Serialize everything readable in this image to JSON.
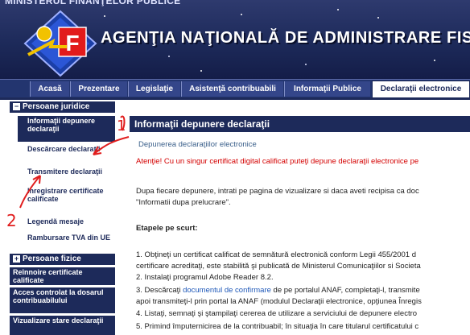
{
  "header": {
    "ministry": "MINISTERUL FINANŢELOR PUBLICE",
    "agency": "AGENŢIA NAŢIONALĂ DE ADMINISTRARE FISCALĂ"
  },
  "tabs": [
    {
      "label": "Acasă"
    },
    {
      "label": "Prezentare"
    },
    {
      "label": "Legislaţie"
    },
    {
      "label": "Asistenţă contribuabili"
    },
    {
      "label": "Informaţii Publice"
    },
    {
      "label": "Declaraţii electronice"
    }
  ],
  "sidebar": {
    "section1": "Persoane juridice",
    "section1_icon": "minus",
    "items": [
      {
        "label": "Informaţii depunere declaraţii"
      },
      {
        "label": "Descărcare declaraţii"
      },
      {
        "label": "Transmitere declaraţii"
      },
      {
        "label": "Inregistrare certificate calificate"
      },
      {
        "label": "Legendă mesaje"
      },
      {
        "label": "Rambursare TVA din UE"
      }
    ],
    "section2": "Persoane fizice",
    "section2_icon": "plus",
    "blocks": [
      {
        "label": "Reînnoire certificate calificate"
      },
      {
        "label": "Acces controlat la dosarul contribuabilului"
      },
      {
        "label": "Vizualizare stare declaraţii"
      }
    ]
  },
  "main": {
    "title": "Informaţii depunere declaraţii",
    "subtitle": "Depunerea declaraţiilor electronice",
    "warning": "Atenţie! Cu un singur certificat digital calificat puteţi depune declaraţii electronice pe",
    "para1_line1": "Dupa fiecare depunere, intrati pe pagina de vizualizare si daca aveti recipisa ca doc",
    "para1_line2": "\"Informatii dupa prelucrare\".",
    "steps_heading": "Etapele pe scurt:",
    "step1_line1": "1. Obţineţi un certificat calificat de semnătură electronică  conform Legii 455/2001 d",
    "step1_line2": "certificare acreditaţi, este stabilită şi publicată de Ministerul Comunicaţiilor si Societa",
    "step2": "2. Instalaţi programul Adobe Reader 8.2.",
    "step3_pre": "3. Descărcaţi ",
    "step3_link": "documentul de confirmare",
    "step3_post": " de pe portalul ANAF, completaţi-l, transmite",
    "step3_line2": "apoi transmiteţi-l prin portal la ANAF (modulul Declaraţii electronice, opţiunea Înregis",
    "step4": "4. Listaţi, semnaţi şi ştampilaţi cererea de utilizare a serviciului de depunere electro",
    "step5": "5. Primind împuternicirea de la contribuabil; în situaţia în care titularul certificatului c"
  },
  "annotations": [
    {
      "label": "1"
    },
    {
      "label": "2"
    }
  ],
  "colors": {
    "navy": "#1d2a5a",
    "warning_red": "#d40000",
    "link_blue": "#1d57b8",
    "annotation_red": "#e11d1d"
  }
}
